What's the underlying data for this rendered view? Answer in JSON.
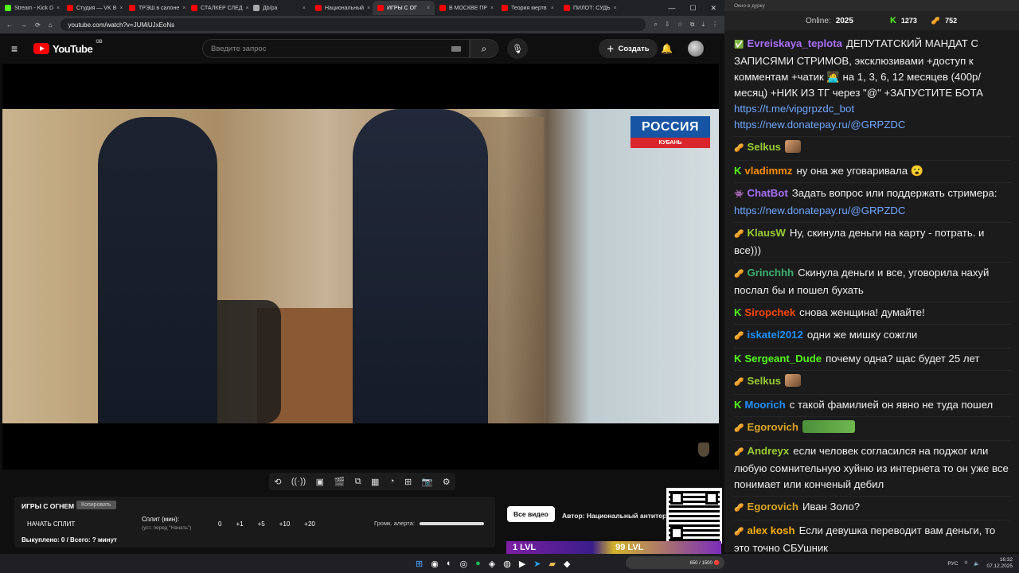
{
  "browser": {
    "tabs": [
      {
        "label": "Stream - Kick D",
        "color": "#53fc18"
      },
      {
        "label": "Студия — VK В",
        "color": "#ff0000"
      },
      {
        "label": "ТРЭШ в салоне",
        "color": "#ff0000"
      },
      {
        "label": "СТАЛКЕР СЛЕД",
        "color": "#ff0000"
      },
      {
        "label": "Дb/ра",
        "color": "#aaaaaa"
      },
      {
        "label": "Национальный",
        "color": "#ff0000"
      },
      {
        "label": "ИГРЫ С ОГ",
        "color": "#ff0000",
        "active": true
      },
      {
        "label": "В МОСКВЕ ПР",
        "color": "#ff0000"
      },
      {
        "label": "Теория мертв",
        "color": "#ff0000"
      },
      {
        "label": "ПИЛОТ: СУДЬ",
        "color": "#ff0000"
      }
    ],
    "url": "youtube.com/watch?v=JUMiUJxEoNs"
  },
  "youtube": {
    "logo": "YouTube",
    "region": "GB",
    "search_placeholder": "Введите запрос",
    "create_label": "Создать"
  },
  "video": {
    "channel_logo_top": "РОССИЯ",
    "channel_logo_bottom": "КУБАНЬ"
  },
  "overlay": {
    "title": "ИГРЫ С ОГНЕМ",
    "copy_label": "Копировать",
    "start_split": "НАЧАТЬ СПЛИТ",
    "split_label": "Сплит (мин):",
    "split_sub": "(уст. перед \"Начать\")",
    "nums": [
      "0",
      "+1",
      "+5",
      "+10",
      "+20"
    ],
    "volume_label": "Громк. алерта:",
    "footer": "Выкуплено: 0 / Всего: ? минут"
  },
  "below_video": {
    "all_videos": "Все видео",
    "author": "Автор: Национальный антитерр",
    "levels": [
      "1 LVL",
      "99 LVL"
    ]
  },
  "chat": {
    "window_title": "Окно в дурку",
    "online_label": "Online:",
    "online_count": "2025",
    "kick_count": "1273",
    "bean_count": "752",
    "messages": [
      {
        "nick": "Evreiskaya_teplota",
        "color": "#a970ff",
        "text": "ДЕПУТАТСКИЙ МАНДАТ С ЗАПИСЯМИ СТРИМОВ, эксклюзивами +доступ к комментам +чатик 🧑‍💻 на 1, 3, 6, 12 месяцев (400р/месяц) +НИК ИЗ ТГ через \"@\" +ЗАПУСТИТЕ БОТА",
        "link1": "https://t.me/vipgrpzdc_bot",
        "link2": "https://new.donatepay.ru/@GRPZDC",
        "ico": "✅"
      },
      {
        "nick": "Selkus",
        "color": "#9acd32",
        "text": "",
        "ico": "🥜"
      },
      {
        "nick": "vladimmz",
        "color": "#ff8c00",
        "text": "ну она же уговаривала 😮",
        "ico": "K"
      },
      {
        "nick": "ChatBot",
        "color": "#a970ff",
        "text": "Задать вопрос или поддержать стримера:",
        "link1": "https://new.donatepay.ru/@GRPZDC",
        "ico": "👾"
      },
      {
        "nick": "KlausW",
        "color": "#9acd32",
        "text": "Ну, скинула деньги на карту - потрать. и все)))",
        "ico": "🥜"
      },
      {
        "nick": "Grinchhh",
        "color": "#3cb371",
        "text": "Скинула деньги и все, уговорила нахуй послал бы и пошел бухать",
        "ico": "🥜"
      },
      {
        "nick": "Siropchek",
        "color": "#ff4500",
        "text": "снова женщина! думайте!",
        "ico": "K"
      },
      {
        "nick": "iskatel2012",
        "color": "#1e90ff",
        "text": "одни же мишку сожгли",
        "ico": "🥜"
      },
      {
        "nick": "Sergeant_Dude",
        "color": "#53fc18",
        "text": "почему одна? щас будет 25 лет",
        "ico": "K"
      },
      {
        "nick": "Selkus",
        "color": "#9acd32",
        "text": "",
        "ico": "🥜"
      },
      {
        "nick": "Moorich",
        "color": "#1e90ff",
        "text": "с такой фамилией он явно не туда пошел",
        "ico": "K"
      },
      {
        "nick": "Egorovich",
        "color": "#daa520",
        "text": "",
        "ico": "🥜"
      },
      {
        "nick": "Andreyx",
        "color": "#9acd32",
        "text": "если человек согласился на поджог или любую сомнительную хуйню из интернета то он уже все понимает или конченый дебил",
        "ico": "🥜"
      },
      {
        "nick": "Egorovich",
        "color": "#daa520",
        "text": "Иван Золо?",
        "ico": "🥜"
      },
      {
        "nick": "alex kosh",
        "color": "#ffb000",
        "text": "Если девушка переводит вам деньги, то это точно СБУшник",
        "ico": "🥜"
      }
    ]
  },
  "taskbar": {
    "lang": "РУС",
    "time": "16:32",
    "date": "07.12.2025",
    "pill": "650 / 1500 🔴"
  }
}
